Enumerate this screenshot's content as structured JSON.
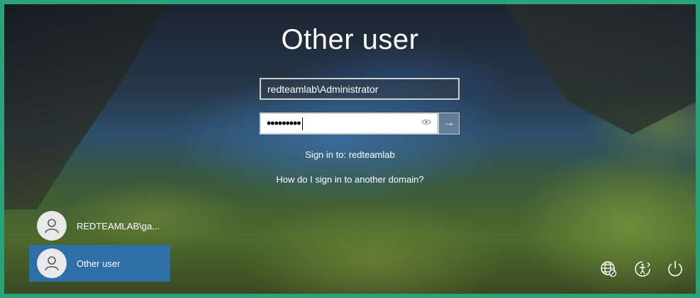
{
  "login": {
    "title": "Other user",
    "username_value": "redteamlab\\Administrator",
    "password_mask": "•••••••••",
    "reveal_icon": "eye-icon",
    "submit_icon": "arrow-right-icon",
    "sign_in_to": "Sign in to: redteamlab",
    "help_link": "How do I sign in to another domain?"
  },
  "users": [
    {
      "label": "REDTEAMLAB\\ga...",
      "icon": "user-avatar-icon",
      "selected": false
    },
    {
      "label": "Other user",
      "icon": "user-avatar-icon",
      "selected": true
    }
  ],
  "system_icons": [
    "network-globe-icon",
    "ease-of-access-icon",
    "power-icon"
  ],
  "colors": {
    "frame": "#2aa37b",
    "selected_tile": "#2f6fa8"
  }
}
